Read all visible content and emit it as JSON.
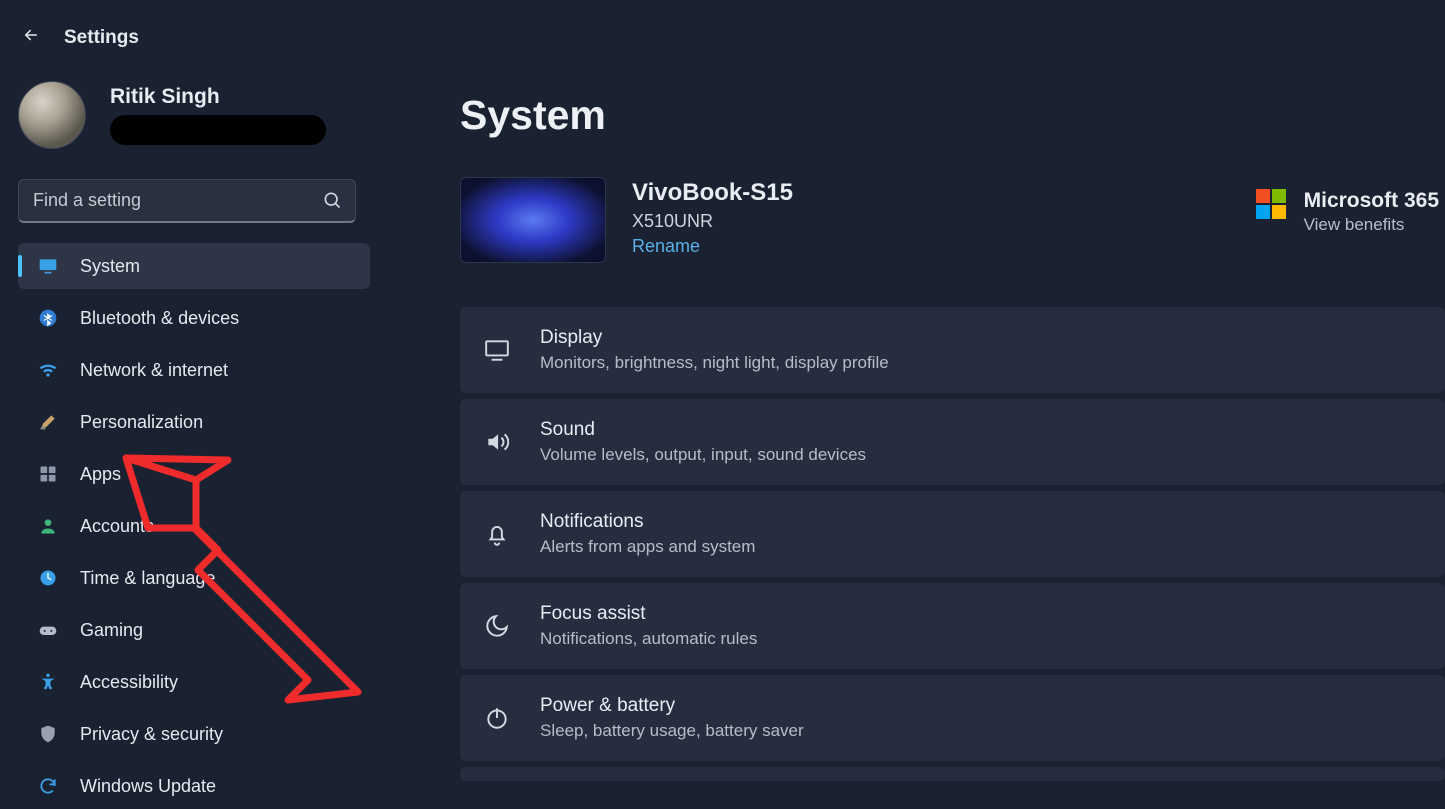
{
  "header": {
    "title": "Settings"
  },
  "profile": {
    "name": "Ritik Singh"
  },
  "search": {
    "placeholder": "Find a setting"
  },
  "sidebar": {
    "items": [
      {
        "label": "System"
      },
      {
        "label": "Bluetooth & devices"
      },
      {
        "label": "Network & internet"
      },
      {
        "label": "Personalization"
      },
      {
        "label": "Apps"
      },
      {
        "label": "Accounts"
      },
      {
        "label": "Time & language"
      },
      {
        "label": "Gaming"
      },
      {
        "label": "Accessibility"
      },
      {
        "label": "Privacy & security"
      },
      {
        "label": "Windows Update"
      }
    ]
  },
  "page": {
    "title": "System"
  },
  "device": {
    "name": "VivoBook-S15",
    "model": "X510UNR",
    "rename_label": "Rename"
  },
  "microsoft365": {
    "title": "Microsoft 365",
    "subtitle": "View benefits"
  },
  "settings_list": [
    {
      "title": "Display",
      "subtitle": "Monitors, brightness, night light, display profile",
      "icon": "display"
    },
    {
      "title": "Sound",
      "subtitle": "Volume levels, output, input, sound devices",
      "icon": "sound"
    },
    {
      "title": "Notifications",
      "subtitle": "Alerts from apps and system",
      "icon": "bell"
    },
    {
      "title": "Focus assist",
      "subtitle": "Notifications, automatic rules",
      "icon": "moon"
    },
    {
      "title": "Power & battery",
      "subtitle": "Sleep, battery usage, battery saver",
      "icon": "power"
    }
  ]
}
